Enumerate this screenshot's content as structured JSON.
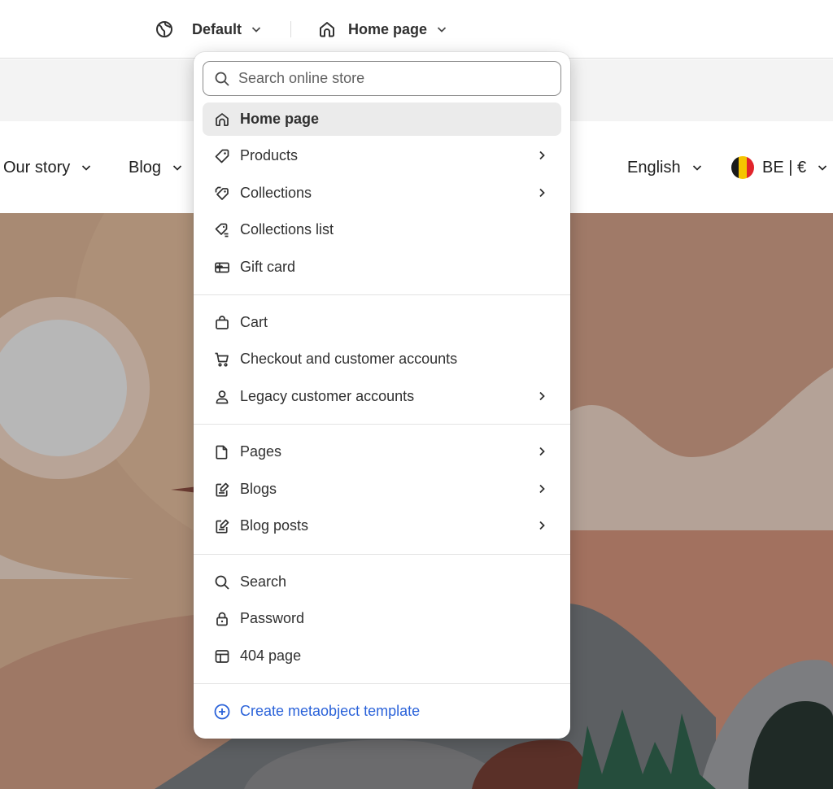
{
  "topbar": {
    "theme_label": "Default",
    "page_label": "Home page"
  },
  "store": {
    "nav": [
      {
        "label": "Our story"
      },
      {
        "label": "Blog"
      }
    ],
    "language": "English",
    "country": "BE | €",
    "flag_colors": [
      "#1a1a1a",
      "#f5c400",
      "#e1242b"
    ]
  },
  "dropdown": {
    "search_placeholder": "Search online store",
    "items": [
      {
        "label": "Home page",
        "icon": "home-icon",
        "active": true
      },
      {
        "label": "Products",
        "icon": "tag-icon",
        "submenu": true
      },
      {
        "label": "Collections",
        "icon": "tags-icon",
        "submenu": true
      },
      {
        "label": "Collections list",
        "icon": "tags-list-icon"
      },
      {
        "label": "Gift card",
        "icon": "gift-card-icon"
      },
      {
        "label": "Cart",
        "icon": "bag-icon"
      },
      {
        "label": "Checkout and customer accounts",
        "icon": "cart-icon"
      },
      {
        "label": "Legacy customer accounts",
        "icon": "person-icon",
        "submenu": true
      },
      {
        "label": "Pages",
        "icon": "page-icon",
        "submenu": true
      },
      {
        "label": "Blogs",
        "icon": "blog-icon",
        "submenu": true
      },
      {
        "label": "Blog posts",
        "icon": "blog-post-icon",
        "submenu": true
      },
      {
        "label": "Search",
        "icon": "search-icon"
      },
      {
        "label": "Password",
        "icon": "lock-icon"
      },
      {
        "label": "404 page",
        "icon": "layout-icon"
      }
    ],
    "create_label": "Create metaobject template"
  },
  "colors": {
    "accent": "#2a62d9",
    "active_bg": "#ebebeb"
  }
}
